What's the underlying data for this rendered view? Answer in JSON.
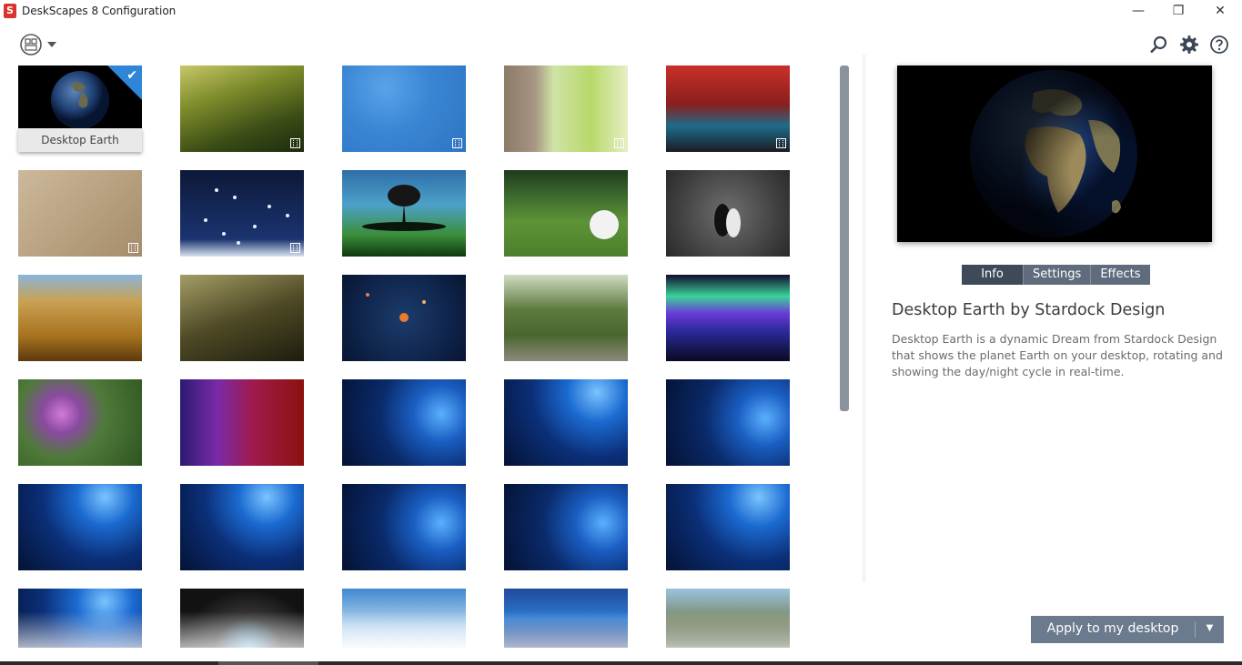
{
  "window": {
    "logo_letter": "S",
    "title": "DeskScapes 8 Configuration",
    "minimize": "—",
    "restore": "❐",
    "close": "✕"
  },
  "toolbar": {
    "view_icon": "view-mode-icon",
    "search_icon": "search-icon",
    "settings_icon": "gear-icon",
    "help_icon": "help-icon"
  },
  "gallery": {
    "selected_label": "Desktop Earth",
    "selected_check": "✔",
    "video_badge_icon": "film-icon",
    "thumbnails": [
      "Desktop Earth",
      "Grass field",
      "Blue abstract",
      "Tree bark and leaf",
      "Retro car scene",
      "Sand",
      "Falling snow",
      "Floating tree island",
      "Golf ball on grass",
      "Cats",
      "Wheat field",
      "Leaf in grass",
      "Solar system",
      "Tree-lined road",
      "Aurora",
      "Pink daisy",
      "Sound wave",
      "Windows 10 hero",
      "Windows 10 hero",
      "Windows 10 hero",
      "Windows 10 hero",
      "Windows 10 hero",
      "Windows 10 hero",
      "Windows 10 hero",
      "Windows 10 hero",
      "Windows 10 hero",
      "Cave arch",
      "Clouds and structure",
      "Underwater",
      "Mountain lake"
    ]
  },
  "colors": {
    "accent": "#2f86d8",
    "tab_bg": "#5e6c7d",
    "tab_active": "#3e4a58",
    "button_bg": "#6b7b8d"
  },
  "tabs": [
    {
      "label": "Info",
      "active": true
    },
    {
      "label": "Settings",
      "active": false
    },
    {
      "label": "Effects",
      "active": false
    }
  ],
  "info": {
    "title": "Desktop Earth by Stardock Design",
    "description": "Desktop Earth is a dynamic Dream from Stardock Design that shows the planet Earth on your desktop, rotating and showing the day/night cycle in real-time."
  },
  "apply": {
    "label": "Apply to my desktop",
    "arrow": "▼"
  }
}
